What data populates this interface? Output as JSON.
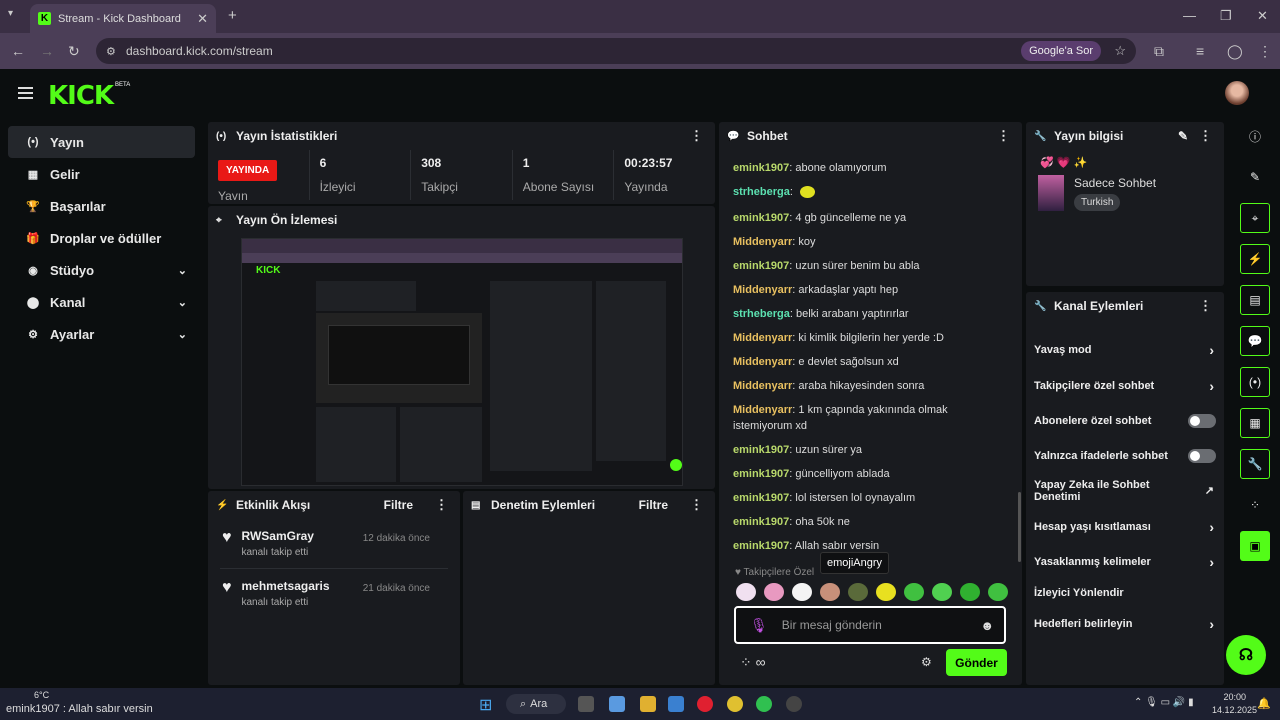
{
  "browser": {
    "tab_title": "Stream - Kick Dashboard",
    "url": "dashboard.kick.com/stream",
    "google_btn": "Google'a Sor"
  },
  "app": {
    "logo": "KICK",
    "beta": "BETA"
  },
  "sidebar": {
    "items": [
      {
        "label": "Yayın",
        "icon": "broadcast-icon",
        "glyph": "(•)"
      },
      {
        "label": "Gelir",
        "icon": "revenue-icon",
        "glyph": "▦"
      },
      {
        "label": "Başarılar",
        "icon": "trophy-icon",
        "glyph": "🏆"
      },
      {
        "label": "Droplar ve ödüller",
        "icon": "gift-icon",
        "glyph": "🎁"
      },
      {
        "label": "Stüdyo",
        "icon": "studio-icon",
        "glyph": "◉"
      },
      {
        "label": "Kanal",
        "icon": "channel-icon",
        "glyph": "⬤"
      },
      {
        "label": "Ayarlar",
        "icon": "settings-icon",
        "glyph": "⚙"
      }
    ]
  },
  "stats": {
    "title": "Yayın İstatistikleri",
    "live_label": "YAYINDA",
    "items": [
      {
        "value": "6",
        "label": "İzleyici"
      },
      {
        "value": "308",
        "label": "Takipçi"
      },
      {
        "value": "1",
        "label": "Abone Sayısı"
      },
      {
        "value": "00:23:57",
        "label": "Yayında"
      }
    ],
    "first_label": "Yayın"
  },
  "preview": {
    "title": "Yayın Ön İzlemesi"
  },
  "activity": {
    "title": "Etkinlik Akışı",
    "filter": "Filtre",
    "items": [
      {
        "name": "RWSamGray",
        "sub": "kanalı takip etti",
        "time": "12 dakika önce"
      },
      {
        "name": "mehmetsagaris",
        "sub": "kanalı takip etti",
        "time": "21 dakika önce"
      }
    ]
  },
  "moderation": {
    "title": "Denetim Eylemleri",
    "filter": "Filtre"
  },
  "chat": {
    "title": "Sohbet",
    "messages": [
      {
        "user": "emink1907",
        "cls": "u-g",
        "text": "abone olamıyorum"
      },
      {
        "user": "strheberga",
        "cls": "u-t",
        "text": ""
      },
      {
        "user": "emink1907",
        "cls": "u-g",
        "text": "4 gb güncelleme ne ya"
      },
      {
        "user": "Middenyarr",
        "cls": "u-o",
        "text": "koy"
      },
      {
        "user": "emink1907",
        "cls": "u-g",
        "text": "uzun sürer benim bu abla"
      },
      {
        "user": "Middenyarr",
        "cls": "u-o",
        "text": "arkadaşlar yaptı hep"
      },
      {
        "user": "strheberga",
        "cls": "u-t",
        "text": "belki arabanı yaptırırlar"
      },
      {
        "user": "Middenyarr",
        "cls": "u-o",
        "text": "ki kimlik bilgilerin her yerde :D"
      },
      {
        "user": "Middenyarr",
        "cls": "u-o",
        "text": "e devlet sağolsun xd"
      },
      {
        "user": "Middenyarr",
        "cls": "u-o",
        "text": "araba hikayesinden sonra"
      },
      {
        "user": "Middenyarr",
        "cls": "u-o",
        "text": "1 km çapında yakınında olmak istemiyorum xd"
      },
      {
        "user": "emink1907",
        "cls": "u-g",
        "text": "uzun sürer ya"
      },
      {
        "user": "emink1907",
        "cls": "u-g",
        "text": "güncelliyom ablada"
      },
      {
        "user": "emink1907",
        "cls": "u-g",
        "text": "lol istersen lol oynayalım"
      },
      {
        "user": "emink1907",
        "cls": "u-g",
        "text": "oha 50k ne"
      },
      {
        "user": "emink1907",
        "cls": "u-g",
        "text": "Allah sabır versin"
      }
    ],
    "followers_only": "Takipçilere Özel",
    "tooltip": "emojiAngry",
    "input_placeholder": "Bir mesaj gönderin",
    "send": "Gönder"
  },
  "stream_info": {
    "title": "Yayın bilgisi",
    "category": "Sadece Sohbet",
    "language": "Turkish"
  },
  "channel_actions": {
    "title": "Kanal Eylemleri",
    "items": [
      {
        "label": "Yavaş mod",
        "kind": "arrow"
      },
      {
        "label": "Takipçilere özel sohbet",
        "kind": "arrow"
      },
      {
        "label": "Abonelere özel sohbet",
        "kind": "toggle"
      },
      {
        "label": "Yalnızca ifadelerle sohbet",
        "kind": "toggle"
      },
      {
        "label": "Yapay Zeka ile Sohbet Denetimi",
        "kind": "ext"
      },
      {
        "label": "Hesap yaşı kısıtlaması",
        "kind": "arrow"
      },
      {
        "label": "Yasaklanmış kelimeler",
        "kind": "arrow"
      },
      {
        "label": "İzleyici Yönlendir",
        "kind": "none"
      },
      {
        "label": "Hedefleri belirleyin",
        "kind": "arrow"
      }
    ]
  },
  "taskbar": {
    "weather": "6°C",
    "ticker": "emink1907 : Allah sabır versin",
    "search": "Ara",
    "time": "20:00",
    "date": "14.12.2025"
  }
}
